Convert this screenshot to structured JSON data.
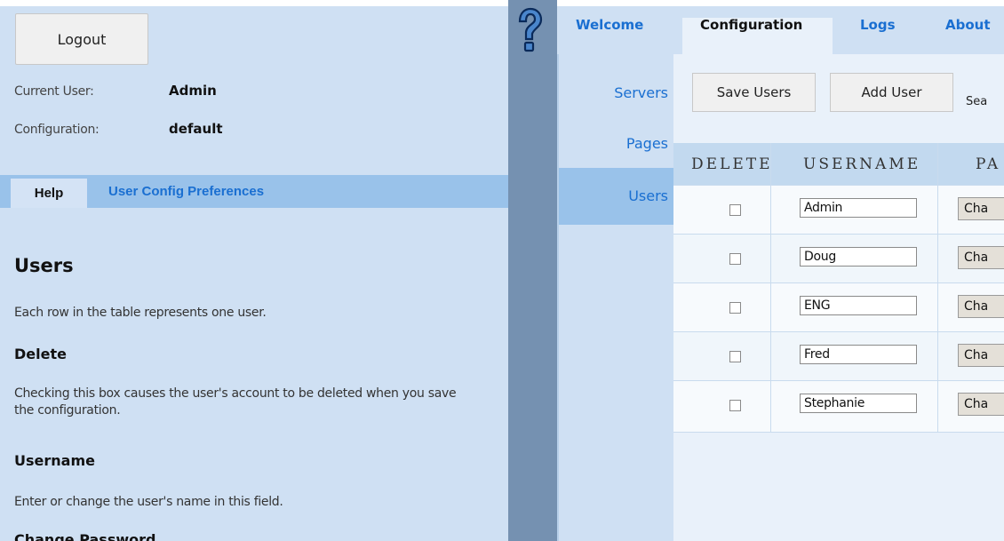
{
  "session": {
    "logout_label": "Logout",
    "current_user_label": "Current User:",
    "current_user_value": "Admin",
    "configuration_label": "Configuration:",
    "configuration_value": "default"
  },
  "help_tabs": [
    {
      "label": "Help",
      "active": true
    },
    {
      "label": "User Config Preferences",
      "active": false
    }
  ],
  "help": {
    "title": "Users",
    "intro": "Each row in the table represents one user.",
    "sections": [
      {
        "heading": "Delete",
        "text": "Checking this box causes the user's account to be deleted when you save the configuration."
      },
      {
        "heading": "Username",
        "text": "Enter or change the user's name in this field."
      },
      {
        "heading": "Change Password",
        "text": ""
      }
    ]
  },
  "main_tabs": [
    {
      "label": "Welcome",
      "active": false
    },
    {
      "label": "Configuration",
      "active": true
    },
    {
      "label": "Logs",
      "active": false
    },
    {
      "label": "About",
      "active": false
    }
  ],
  "side_nav": [
    {
      "label": "Servers",
      "active": false
    },
    {
      "label": "Pages",
      "active": false
    },
    {
      "label": "Users",
      "active": true
    }
  ],
  "toolbar": {
    "save_label": "Save Users",
    "add_label": "Add User",
    "search_label": "Sea"
  },
  "table": {
    "headers": [
      "DELETE",
      "USERNAME",
      "PA"
    ],
    "rows": [
      {
        "username": "Admin",
        "action": "Cha",
        "checked": false
      },
      {
        "username": "Doug",
        "action": "Cha",
        "checked": false
      },
      {
        "username": "ENG",
        "action": "Cha",
        "checked": false
      },
      {
        "username": "Fred",
        "action": "Cha",
        "checked": false
      },
      {
        "username": "Stephanie",
        "action": "Cha",
        "checked": false
      }
    ]
  },
  "colors": {
    "panel_bg": "#cfe0f3",
    "tab_strip": "#99c2ea",
    "divider": "#7591b1",
    "link_blue": "#1a6fd1"
  },
  "icons": {
    "help": "question-mark-icon"
  }
}
